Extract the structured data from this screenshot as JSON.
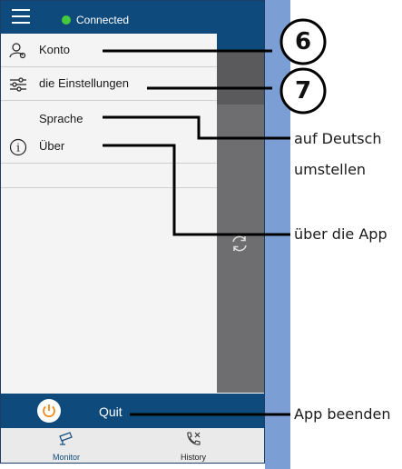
{
  "header": {
    "status_text": "Connected",
    "status_color": "#46c93a",
    "bar_color": "#0f4a7c"
  },
  "menu": {
    "items": [
      {
        "label": "Konto",
        "icon": "account-settings-icon"
      },
      {
        "label": "die Einstellungen",
        "icon": "sliders-icon"
      },
      {
        "label": "Sprache",
        "icon": ""
      },
      {
        "label": "Über",
        "icon": "info-icon"
      }
    ]
  },
  "quit": {
    "label": "Quit",
    "icon": "power-icon"
  },
  "bottom_nav": {
    "items": [
      {
        "label": "Monitor",
        "icon": "camera-icon"
      },
      {
        "label": "History",
        "icon": "phone-history-icon"
      }
    ]
  },
  "callouts": {
    "badge_6": "6",
    "badge_7": "7",
    "language_line1": "auf Deutsch",
    "language_line2": "umstellen",
    "about": "über die App",
    "quit": "App beenden"
  }
}
